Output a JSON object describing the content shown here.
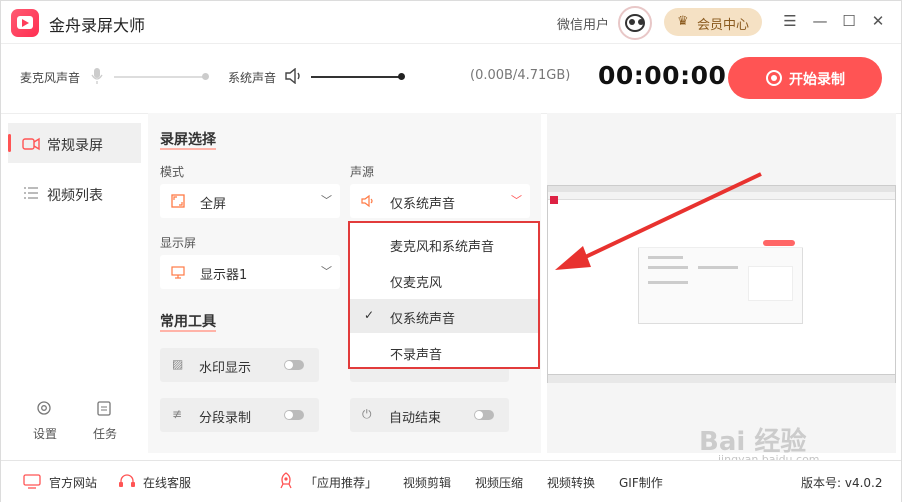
{
  "app": {
    "title": "金舟录屏大师",
    "user": "微信用户",
    "vip_label": "会员中心"
  },
  "window_controls": {
    "menu": "☰",
    "minimize": "—",
    "maximize": "☐",
    "close": "✕"
  },
  "audio": {
    "mic_label": "麦克风声音",
    "system_label": "系统声音",
    "storage": "(0.00B/4.71GB)",
    "timer": "00:00:00",
    "record_label": "开始录制",
    "system_volume_fraction": 0.75
  },
  "nav": {
    "items": [
      {
        "label": "常规录屏"
      },
      {
        "label": "视频列表"
      }
    ],
    "settings": "设置",
    "tasks": "任务"
  },
  "panel": {
    "section_title": "录屏选择",
    "mode_label": "模式",
    "mode_value": "全屏",
    "source_label": "声源",
    "source_value": "仅系统声音",
    "display_label": "显示屏",
    "display_value": "显示器1",
    "tools_title": "常用工具",
    "tools": [
      {
        "label": "水印显示"
      },
      {
        "label": "分段录制"
      },
      {
        "label": "自动结束"
      }
    ]
  },
  "dropdown": {
    "options": [
      "麦克风和系统声音",
      "仅麦克风",
      "仅系统声音",
      "不录声音"
    ],
    "selected": "仅系统声音"
  },
  "footer": {
    "website": "官方网站",
    "support": "在线客服",
    "recommend": "「应用推荐」",
    "links": [
      "视频剪辑",
      "视频压缩",
      "视频转换",
      "GIF制作"
    ],
    "version": "版本号: v4.0.2"
  },
  "watermark": {
    "text": "Bai 经验",
    "url": "jingyan.baidu.com"
  },
  "colors": {
    "accent": "#ff5454",
    "highlight_border": "#e23b3b",
    "arrow": "#e8322f"
  }
}
